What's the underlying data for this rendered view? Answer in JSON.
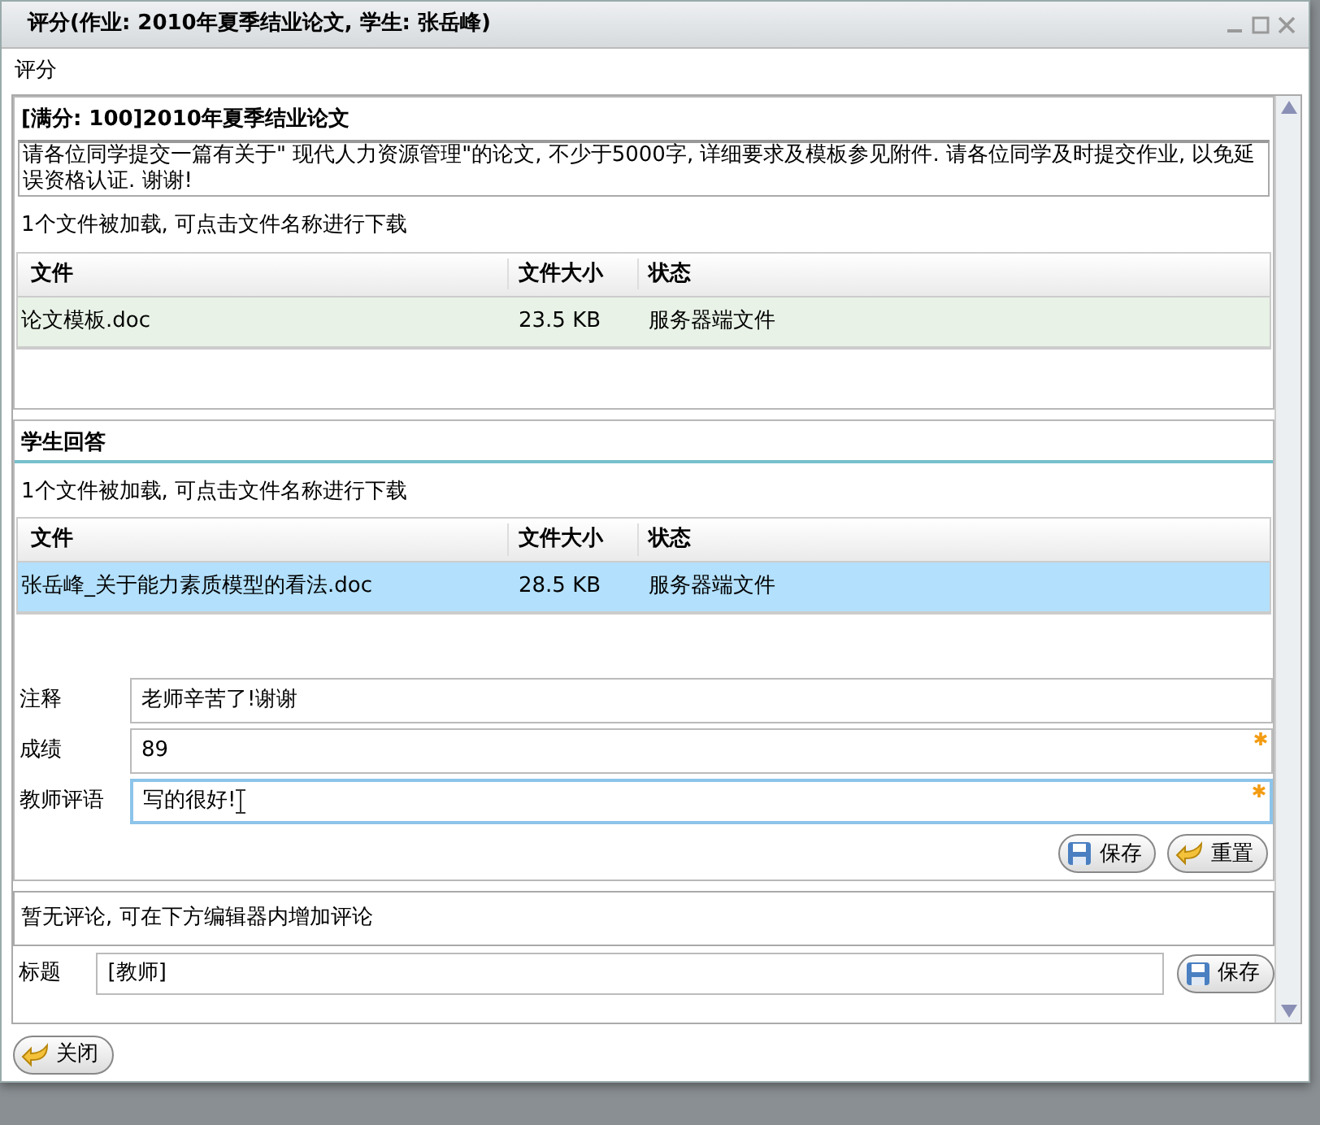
{
  "window": {
    "title": "评分(作业: 2010年夏季结业论文, 学生: 张岳峰)"
  },
  "section_label": "评分",
  "assignment": {
    "title": "[满分: 100]2010年夏季结业论文",
    "description": "请各位同学提交一篇有关于\" 现代人力资源管理\"的论文, 不少于5000字, 详细要求及模板参见附件. 请各位同学及时提交作业, 以免延误资格认证. 谢谢!",
    "files_note": "1个文件被加载, 可点击文件名称进行下载",
    "columns": [
      "文件",
      "文件大小",
      "状态"
    ],
    "rows": [
      {
        "cells": [
          "论文模板.doc",
          "23.5 KB",
          "服务器端文件"
        ],
        "selected": false
      }
    ]
  },
  "answer": {
    "title": "学生回答",
    "files_note": "1个文件被加载, 可点击文件名称进行下载",
    "columns": [
      "文件",
      "文件大小",
      "状态"
    ],
    "rows": [
      {
        "cells": [
          "张岳峰_关于能力素质模型的看法.doc",
          "28.5 KB",
          "服务器端文件"
        ],
        "selected": true
      }
    ],
    "fields": [
      {
        "label": "注释",
        "value": "老师辛苦了!谢谢",
        "required": false,
        "focused": false
      },
      {
        "label": "成绩",
        "value": "89",
        "required": true,
        "focused": false
      },
      {
        "label": "教师评语",
        "value": "写的很好!",
        "required": true,
        "focused": true
      }
    ],
    "buttons": [
      {
        "label": "保存",
        "kind": "save"
      },
      {
        "label": "重置",
        "kind": "reset"
      }
    ]
  },
  "comments": {
    "note": "暂无评论, 可在下方编辑器内增加评论",
    "title_label": "标题",
    "title_value": "[教师]",
    "button": {
      "label": "保存",
      "kind": "save"
    }
  },
  "footer_buttons": [
    {
      "label": "关闭",
      "kind": "reset"
    }
  ]
}
